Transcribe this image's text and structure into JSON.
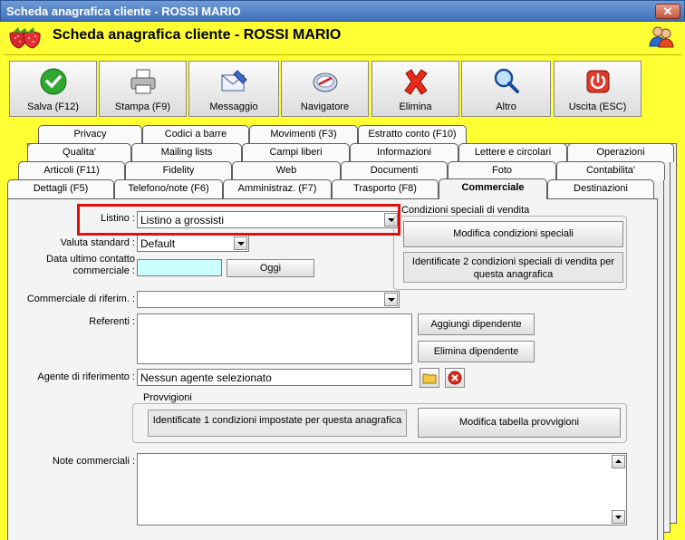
{
  "window": {
    "title": "Scheda anagrafica cliente - ROSSI MARIO",
    "close_label": "✕"
  },
  "header": {
    "title": "Scheda anagrafica cliente - ROSSI MARIO"
  },
  "toolbar": [
    {
      "id": "salva",
      "label": "Salva (F12)",
      "icon": "check-icon"
    },
    {
      "id": "stampa",
      "label": "Stampa (F9)",
      "icon": "printer-icon"
    },
    {
      "id": "messaggio",
      "label": "Messaggio",
      "icon": "envelope-icon"
    },
    {
      "id": "navigatore",
      "label": "Navigatore",
      "icon": "compass-icon"
    },
    {
      "id": "elimina",
      "label": "Elimina",
      "icon": "x-icon"
    },
    {
      "id": "altro",
      "label": "Altro",
      "icon": "magnifier-icon"
    },
    {
      "id": "uscita",
      "label": "Uscita (ESC)",
      "icon": "power-icon"
    }
  ],
  "tabs": {
    "row1": [
      "Privacy",
      "Codici a barre",
      "Movimenti (F3)",
      "Estratto conto (F10)"
    ],
    "row2": [
      "Qualita'",
      "Mailing lists",
      "Campi liberi",
      "Informazioni",
      "Lettere e circolari",
      "Operazioni"
    ],
    "row3": [
      "Articoli (F11)",
      "Fidelity",
      "Web",
      "Documenti",
      "Foto",
      "Contabilita'"
    ],
    "row4": [
      "Dettagli (F5)",
      "Telefono/note (F6)",
      "Amministraz. (F7)",
      "Trasporto (F8)",
      "Commerciale",
      "Destinazioni"
    ],
    "active": "Commerciale"
  },
  "form": {
    "listino_label": "Listino :",
    "listino_value": "Listino a grossisti",
    "valuta_label": "Valuta standard :",
    "valuta_value": "Default",
    "data_label_1": "Data ultimo contatto",
    "data_label_2": "commerciale :",
    "data_value": "",
    "oggi_label": "Oggi",
    "commerciale_label": "Commerciale di riferim. :",
    "commerciale_value": "",
    "referenti_label": "Referenti :",
    "aggiungi_label": "Aggiungi dipendente",
    "elimina_dip_label": "Elimina dipendente",
    "agente_label": "Agente di riferimento :",
    "agente_value": "Nessun agente selezionato",
    "note_label": "Note commerciali :"
  },
  "condizioni": {
    "title": "Condizioni speciali di vendita",
    "button_label": "Modifica condizioni speciali",
    "info_line1": "Identificate 2 condizioni speciali di vendita per",
    "info_line2": "questa anagrafica"
  },
  "provvigioni": {
    "title": "Provvigioni",
    "info": "Identificate 1 condizioni impostate per questa anagrafica",
    "button_label": "Modifica tabella provvigioni"
  },
  "colors": {
    "background": "#ffff33",
    "highlight": "#e01010",
    "titlebar": "#3f6fb8",
    "date_field": "#ccffff"
  }
}
